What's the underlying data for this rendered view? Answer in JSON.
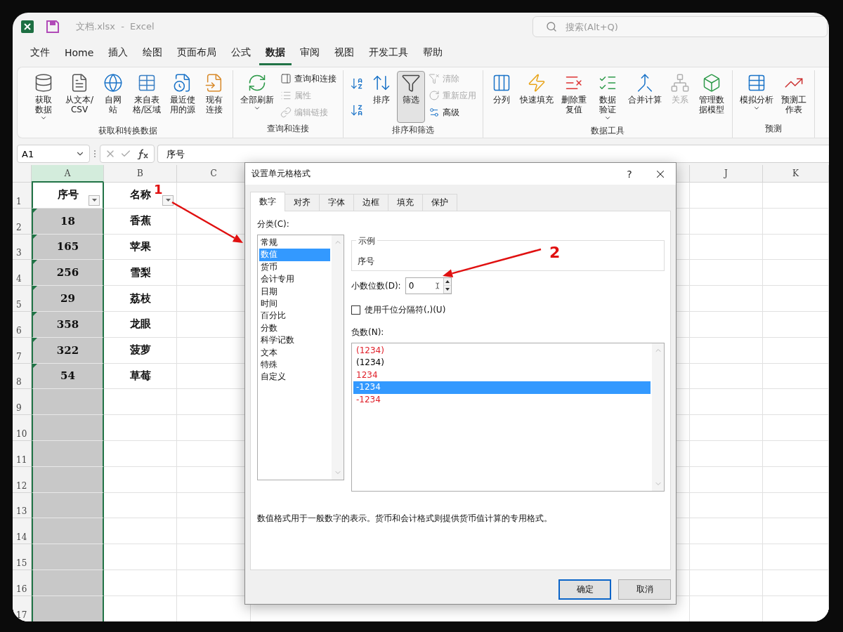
{
  "window": {
    "title": "文档.xlsx  -  Excel",
    "search": {
      "placeholder": "搜索(Alt+Q)"
    }
  },
  "menu_tabs": [
    {
      "label": "文件",
      "selected": false
    },
    {
      "label": "Home",
      "selected": false
    },
    {
      "label": "插入",
      "selected": false
    },
    {
      "label": "绘图",
      "selected": false
    },
    {
      "label": "页面布局",
      "selected": false
    },
    {
      "label": "公式",
      "selected": false
    },
    {
      "label": "数据",
      "selected": true
    },
    {
      "label": "审阅",
      "selected": false
    },
    {
      "label": "视图",
      "selected": false
    },
    {
      "label": "开发工具",
      "selected": false
    },
    {
      "label": "帮助",
      "selected": false
    }
  ],
  "ribbon": {
    "groups": [
      {
        "title": "获取和转换数据",
        "columns": [
          [
            {
              "kind": "large",
              "label": "获取数据",
              "has_menu": true,
              "disabled": false,
              "pressed": false
            }
          ],
          [
            {
              "kind": "large",
              "label": "从文本/CSV",
              "has_menu": false,
              "disabled": false,
              "pressed": false
            }
          ],
          [
            {
              "kind": "large",
              "label": "自网站",
              "has_menu": false,
              "disabled": false,
              "pressed": false
            }
          ],
          [
            {
              "kind": "large",
              "label": "来自表格/区域",
              "has_menu": false,
              "disabled": false,
              "pressed": false
            }
          ],
          [
            {
              "kind": "large",
              "label": "最近使用的源",
              "has_menu": false,
              "disabled": false,
              "pressed": false
            }
          ],
          [
            {
              "kind": "large",
              "label": "现有连接",
              "has_menu": false,
              "disabled": false,
              "pressed": false
            }
          ]
        ]
      },
      {
        "title": "查询和连接",
        "columns": [
          [
            {
              "kind": "large",
              "label": "全部刷新",
              "has_menu": true,
              "disabled": false,
              "pressed": false
            }
          ],
          [
            {
              "kind": "small",
              "label": "查询和连接",
              "has_menu": false,
              "disabled": false,
              "pressed": false
            },
            {
              "kind": "small",
              "label": "属性",
              "has_menu": false,
              "disabled": true,
              "pressed": false
            },
            {
              "kind": "small",
              "label": "编辑链接",
              "has_menu": false,
              "disabled": true,
              "pressed": false
            }
          ]
        ]
      },
      {
        "title": "排序和筛选",
        "columns": [
          [
            {
              "kind": "icon",
              "has_menu": false,
              "disabled": false,
              "pressed": false
            },
            {
              "kind": "icon",
              "has_menu": false,
              "disabled": false,
              "pressed": false
            }
          ],
          [
            {
              "kind": "large",
              "label": "排序",
              "has_menu": false,
              "disabled": false,
              "pressed": false
            }
          ],
          [
            {
              "kind": "large",
              "label": "筛选",
              "has_menu": false,
              "disabled": false,
              "pressed": true
            }
          ],
          [
            {
              "kind": "small",
              "label": "清除",
              "has_menu": false,
              "disabled": true,
              "pressed": false
            },
            {
              "kind": "small",
              "label": "重新应用",
              "has_menu": false,
              "disabled": true,
              "pressed": false
            },
            {
              "kind": "small",
              "label": "高级",
              "has_menu": false,
              "disabled": false,
              "pressed": false
            }
          ]
        ]
      },
      {
        "title": "数据工具",
        "columns": [
          [
            {
              "kind": "large",
              "label": "分列",
              "has_menu": false,
              "disabled": false,
              "pressed": false
            }
          ],
          [
            {
              "kind": "large",
              "label": "快速填充",
              "has_menu": false,
              "disabled": false,
              "pressed": false
            }
          ],
          [
            {
              "kind": "large",
              "label": "删除重复值",
              "has_menu": false,
              "disabled": false,
              "pressed": false
            }
          ],
          [
            {
              "kind": "large",
              "label": "数据验证",
              "has_menu": true,
              "disabled": false,
              "pressed": false
            }
          ],
          [
            {
              "kind": "large",
              "label": "合并计算",
              "has_menu": false,
              "disabled": false,
              "pressed": false
            }
          ],
          [
            {
              "kind": "large",
              "label": "关系",
              "has_menu": false,
              "disabled": true,
              "pressed": false
            }
          ],
          [
            {
              "kind": "large",
              "label": "管理数据模型",
              "has_menu": false,
              "disabled": false,
              "pressed": false
            }
          ]
        ]
      },
      {
        "title": "预测",
        "columns": [
          [
            {
              "kind": "large",
              "label": "模拟分析",
              "has_menu": true,
              "disabled": false,
              "pressed": false
            }
          ],
          [
            {
              "kind": "large",
              "label": "预测工作表",
              "has_menu": false,
              "disabled": false,
              "pressed": false
            }
          ]
        ]
      }
    ]
  },
  "formula_bar": {
    "name_box": "A1",
    "formula": "序号"
  },
  "sheet": {
    "columns": [
      {
        "label": "A",
        "selected": true
      },
      {
        "label": "B",
        "selected": false
      },
      {
        "label": "C",
        "selected": false
      },
      {
        "label": "J",
        "selected": false
      },
      {
        "label": "K",
        "selected": false
      }
    ],
    "rows": [
      {
        "label": "1",
        "kind": "header",
        "cells": [
          "序号",
          "名称"
        ]
      },
      {
        "label": "2",
        "kind": "data",
        "cells": [
          "18",
          "香蕉"
        ]
      },
      {
        "label": "3",
        "kind": "data",
        "cells": [
          "165",
          "苹果"
        ]
      },
      {
        "label": "4",
        "kind": "data",
        "cells": [
          "256",
          "雪梨"
        ]
      },
      {
        "label": "5",
        "kind": "data",
        "cells": [
          "29",
          "荔枝"
        ]
      },
      {
        "label": "6",
        "kind": "data",
        "cells": [
          "358",
          "龙眼"
        ]
      },
      {
        "label": "7",
        "kind": "data",
        "cells": [
          "322",
          "菠萝"
        ]
      },
      {
        "label": "8",
        "kind": "data",
        "cells": [
          "54",
          "草莓"
        ]
      },
      {
        "label": "9",
        "kind": "empty"
      },
      {
        "label": "10",
        "kind": "empty"
      },
      {
        "label": "11",
        "kind": "empty"
      },
      {
        "label": "12",
        "kind": "empty"
      },
      {
        "label": "13",
        "kind": "empty"
      },
      {
        "label": "14",
        "kind": "empty"
      },
      {
        "label": "15",
        "kind": "empty"
      },
      {
        "label": "16",
        "kind": "empty"
      },
      {
        "label": "17",
        "kind": "empty"
      }
    ]
  },
  "dialog": {
    "title": "设置单元格格式",
    "help": "?",
    "tabs": [
      {
        "label": "数字",
        "selected": true
      },
      {
        "label": "对齐",
        "selected": false
      },
      {
        "label": "字体",
        "selected": false
      },
      {
        "label": "边框",
        "selected": false
      },
      {
        "label": "填充",
        "selected": false
      },
      {
        "label": "保护",
        "selected": false
      }
    ],
    "category_label": "分类(C):",
    "categories": [
      {
        "label": "常规",
        "selected": false
      },
      {
        "label": "数值",
        "selected": true
      },
      {
        "label": "货币",
        "selected": false
      },
      {
        "label": "会计专用",
        "selected": false
      },
      {
        "label": "日期",
        "selected": false
      },
      {
        "label": "时间",
        "selected": false
      },
      {
        "label": "百分比",
        "selected": false
      },
      {
        "label": "分数",
        "selected": false
      },
      {
        "label": "科学记数",
        "selected": false
      },
      {
        "label": "文本",
        "selected": false
      },
      {
        "label": "特殊",
        "selected": false
      },
      {
        "label": "自定义",
        "selected": false
      }
    ],
    "sample": {
      "legend": "示例",
      "value": "序号"
    },
    "decimal": {
      "label": "小数位数(D):",
      "value": "0"
    },
    "thousands": {
      "label": "使用千位分隔符(,)(U)",
      "checked": false
    },
    "negative": {
      "label": "负数(N):",
      "options": [
        {
          "label": "(1234)",
          "color": "#e0202a",
          "selected": false
        },
        {
          "label": "(1234)",
          "color": "#000000",
          "selected": false
        },
        {
          "label": "1234",
          "color": "#e0202a",
          "selected": false
        },
        {
          "label": "-1234",
          "selected": true
        },
        {
          "label": "-1234",
          "color": "#e0202a",
          "selected": false
        }
      ]
    },
    "description": "数值格式用于一般数字的表示。货币和会计格式则提供货币值计算的专用格式。",
    "buttons": [
      {
        "label": "确定",
        "kind": "default"
      },
      {
        "label": "取消",
        "kind": "normal"
      }
    ]
  },
  "annotations": [
    {
      "label": "1"
    },
    {
      "label": "2"
    }
  ]
}
